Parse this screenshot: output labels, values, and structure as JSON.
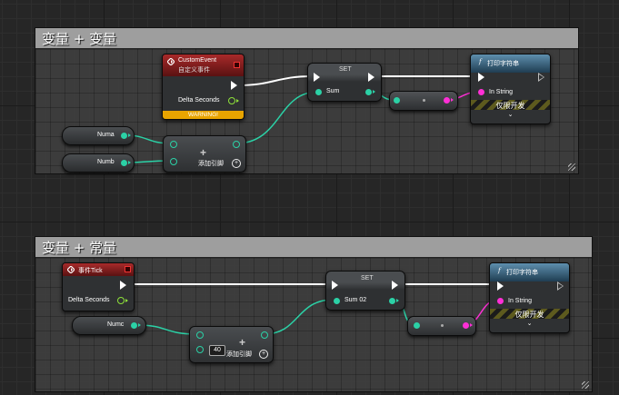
{
  "colors": {
    "exec": "#ffffff",
    "integer": "#2bd1a6",
    "string": "#ff2fd6",
    "event_header": "#a82a2a",
    "function_header": "#3d6e8f",
    "warning": "#e8a400"
  },
  "comment1": {
    "title": "变量 + 变量",
    "custom_event": {
      "title": "CustomEvent",
      "subtitle": "自定义事件",
      "output_label": "Delta Seconds",
      "warning": "WARNING!"
    },
    "numa": "Numa",
    "numb": "Numb",
    "add_node": {
      "add_pin_label": "添加引脚"
    },
    "set_node": {
      "title": "SET",
      "var_label": "Sum"
    },
    "print_node": {
      "title": "打印字符串",
      "input_label": "In String",
      "dev_only": "仅限开发",
      "chevron": "⌄"
    }
  },
  "comment2": {
    "title": "变量 + 常量",
    "event_tick": {
      "title": "事件Tick",
      "output_label": "Delta Seconds"
    },
    "numc": "Numc",
    "add_node": {
      "const_value": "40",
      "add_pin_label": "添加引脚"
    },
    "set_node": {
      "title": "SET",
      "var_label": "Sum 02"
    },
    "print_node": {
      "title": "打印字符串",
      "input_label": "In String",
      "dev_only": "仅限开发",
      "chevron": "⌄"
    }
  }
}
